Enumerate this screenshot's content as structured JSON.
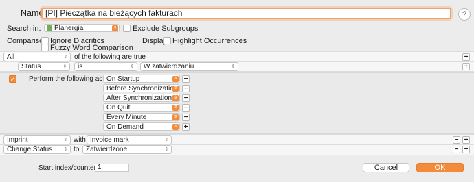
{
  "name": {
    "label": "Name:",
    "value": "[PI] Pieczątka na bieżących fakturach"
  },
  "help": {
    "label": "?"
  },
  "search_in": {
    "label": "Search in:",
    "value": "Planergia",
    "exclude_subgroups": "Exclude Subgroups"
  },
  "comparison": {
    "label": "Comparison:",
    "ignore_diacritics": "Ignore Diacritics",
    "fuzzy": "Fuzzy Word Comparison"
  },
  "display": {
    "label": "Display:",
    "highlight": "Highlight Occurrences"
  },
  "criteria": {
    "match_value": "All",
    "match_suffix": "of the following are true",
    "rule": {
      "field": "Status",
      "operator": "is",
      "value": "W zatwierdzaniu"
    }
  },
  "actions": {
    "perform_label": "Perform the following actions:",
    "triggers": [
      "On Startup",
      "Before Synchronization",
      "After Synchronization",
      "On Quit",
      "Every Minute",
      "On Demand"
    ]
  },
  "imprint_row": {
    "action": "Imprint",
    "with_label": "with",
    "value": "Invoice mark"
  },
  "status_row": {
    "action": "Change Status",
    "to_label": "to",
    "value": "Zatwierdzone"
  },
  "counter": {
    "label": "Start index/counter at:",
    "value": "1"
  },
  "buttons": {
    "cancel": "Cancel",
    "ok": "OK"
  },
  "glyphs": {
    "plus": "+",
    "minus": "−",
    "check": "✓",
    "chevron": "⌃⌄",
    "down": "▾",
    "updown": "⇕"
  },
  "colors": {
    "accent": "#f28b3a",
    "focus_ring": "#f0a36f"
  }
}
